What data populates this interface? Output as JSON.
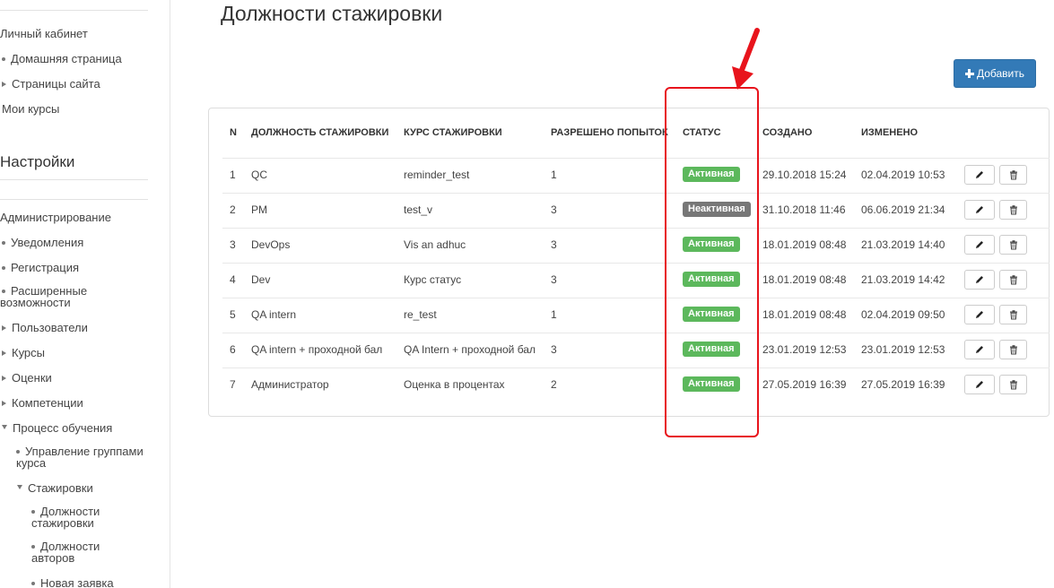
{
  "sidebar": {
    "items": [
      {
        "label": "Личный кабинет"
      },
      {
        "label": "Домашняя страница"
      },
      {
        "label": "Страницы сайта"
      },
      {
        "label": "Мои курсы"
      },
      {
        "label": "Администрирование"
      },
      {
        "label": "Уведомления"
      },
      {
        "label": "Регистрация"
      },
      {
        "label": "Расширенные возможности"
      },
      {
        "label": "Пользователи"
      },
      {
        "label": "Курсы"
      },
      {
        "label": "Оценки"
      },
      {
        "label": "Компетенции"
      },
      {
        "label": "Процесс обучения"
      },
      {
        "label": "Управление группами курса"
      },
      {
        "label": "Стажировки"
      },
      {
        "label": "Должности стажировки"
      },
      {
        "label": "Должности авторов"
      },
      {
        "label": "Новая заявка"
      }
    ],
    "settings_heading": "Настройки"
  },
  "page": {
    "title": "Должности стажировки",
    "add_label": "Добавить"
  },
  "table": {
    "headers": {
      "n": "N",
      "position": "ДОЛЖНОСТЬ СТАЖИРОВКИ",
      "course": "КУРС СТАЖИРОВКИ",
      "attempts": "РАЗРЕШЕНО ПОПЫТОК",
      "status": "СТАТУС",
      "created": "СОЗДАНО",
      "modified": "ИЗМЕНЕНО"
    },
    "rows": [
      {
        "n": "1",
        "position": "QC",
        "course": "reminder_test",
        "attempts": "1",
        "status": "Активная",
        "status_type": "active",
        "created": "29.10.2018 15:24",
        "modified": "02.04.2019 10:53"
      },
      {
        "n": "2",
        "position": "PM",
        "course": "test_v",
        "attempts": "3",
        "status": "Неактивная",
        "status_type": "inactive",
        "created": "31.10.2018 11:46",
        "modified": "06.06.2019 21:34"
      },
      {
        "n": "3",
        "position": "DevOps",
        "course": "Vis an adhuc",
        "attempts": "3",
        "status": "Активная",
        "status_type": "active",
        "created": "18.01.2019 08:48",
        "modified": "21.03.2019 14:40"
      },
      {
        "n": "4",
        "position": "Dev",
        "course": "Курс статус",
        "attempts": "3",
        "status": "Активная",
        "status_type": "active",
        "created": "18.01.2019 08:48",
        "modified": "21.03.2019 14:42"
      },
      {
        "n": "5",
        "position": "QA intern",
        "course": "re_test",
        "attempts": "1",
        "status": "Активная",
        "status_type": "active",
        "created": "18.01.2019 08:48",
        "modified": "02.04.2019 09:50"
      },
      {
        "n": "6",
        "position": "QA intern + проходной бал",
        "course": "QA Intern + проходной бал",
        "attempts": "3",
        "status": "Активная",
        "status_type": "active",
        "created": "23.01.2019 12:53",
        "modified": "23.01.2019 12:53"
      },
      {
        "n": "7",
        "position": "Администратор",
        "course": "Оценка в процентах",
        "attempts": "2",
        "status": "Активная",
        "status_type": "active",
        "created": "27.05.2019 16:39",
        "modified": "27.05.2019 16:39"
      }
    ]
  },
  "colors": {
    "primary": "#337ab7",
    "active": "#5cb85c",
    "inactive": "#777777",
    "annotation": "#e8141c"
  }
}
